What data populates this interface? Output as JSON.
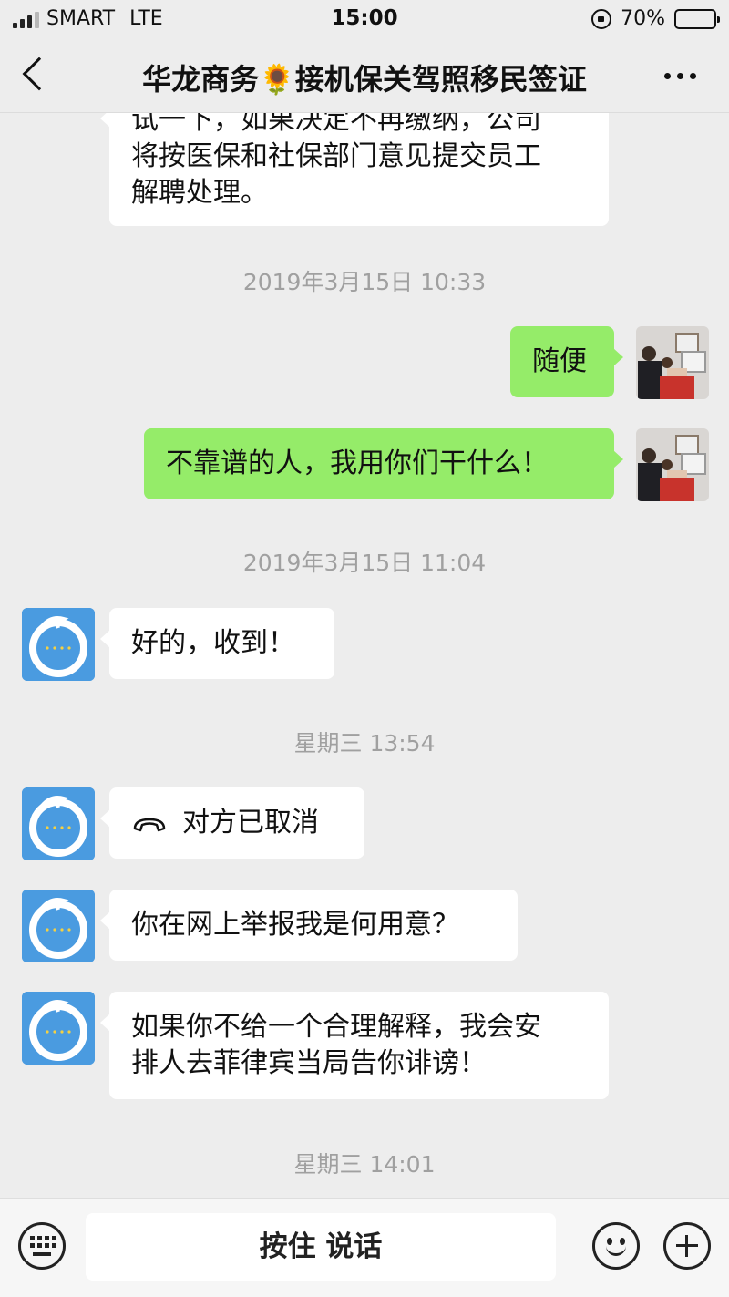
{
  "status_bar": {
    "carrier": "SMART",
    "network": "LTE",
    "time": "15:00",
    "battery": "70%",
    "battery_level": 0.7
  },
  "header": {
    "title": "华龙商务🌻接机保关驾照移民签证"
  },
  "messages": [
    {
      "kind": "text",
      "sender": "contact",
      "text_line1": "试一下，如果决定不再缴纳，公司",
      "text_line2": "将按医保和社保部门意见提交员工",
      "text_line3": "解聘处理。"
    },
    {
      "kind": "time",
      "text": "2019年3月15日 10:33"
    },
    {
      "kind": "text",
      "sender": "me",
      "text": "随便"
    },
    {
      "kind": "text",
      "sender": "me",
      "text": "不靠谱的人，我用你们干什么！"
    },
    {
      "kind": "time",
      "text": "2019年3月15日 11:04"
    },
    {
      "kind": "text",
      "sender": "contact",
      "text": "好的，收到！"
    },
    {
      "kind": "time",
      "text": "星期三 13:54"
    },
    {
      "kind": "call",
      "sender": "contact",
      "icon": "phone-hangup-icon",
      "text": "对方已取消"
    },
    {
      "kind": "text",
      "sender": "contact",
      "text": "你在网上举报我是何用意？"
    },
    {
      "kind": "text",
      "sender": "contact",
      "text_line1": "如果你不给一个合理解释，我会安",
      "text_line2": "排人去菲律宾当局告你诽谤！"
    },
    {
      "kind": "time",
      "text": "星期三 14:01"
    }
  ],
  "input_bar": {
    "hold_to_talk": "按住 说话"
  },
  "colors": {
    "background": "#ededed",
    "incoming_bubble": "#ffffff",
    "outgoing_bubble": "#95ec69",
    "brand_avatar": "#4a9be0"
  }
}
